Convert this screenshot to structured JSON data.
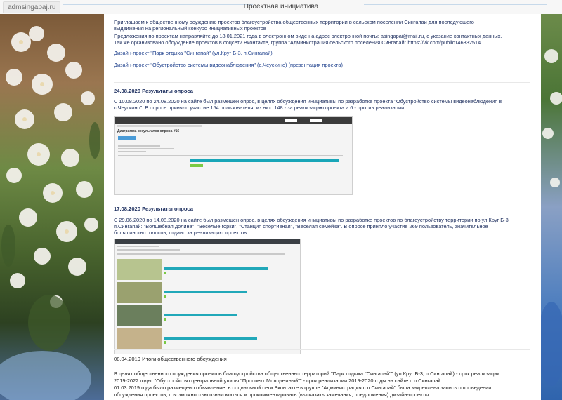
{
  "site_tab": "admsingapaj.ru",
  "page_caption": "Проектная инициатива",
  "intro": {
    "line1": "Приглашаем к общественному осуждению проектов благоустройства общественных территории в сельском поселении Сингапаи для последующего",
    "line2": "выдвижения на региональный конкурс инициативных проектов",
    "line3": "Предложения по проектам направляйте до 18.01.2021 года в электронном виде на адрес электронной почты: asingapai@mail.ru, с указание контактных данных.",
    "line4": "Так же организовано обсуждение проектов в соцсети Вконтакте, группа \"Администрация сельского поселения Сингапай\" https://vk.com/public146332514",
    "link1": "Дизайн-проект \"Парк отдыха \"Сингапай\" (ул.Круг Б-3, п.Сингапай)",
    "link2": "Дизайн-проект \"Обустройство системы видеонаблюдения\" (с.Чеускино) (презентация проекта)"
  },
  "section1": {
    "date": "24.08.2020 Результаты опроса",
    "line1": "С 10.08.2020 по 24.08.2020 на сайте был размещен опрос, в целях обсуждения инициативы по разработке проекта \"Обустройство системы видеонаблюдения в",
    "line2": "с.Чеускино\". В опросе приняло участие 154 пользователя, из них: 148 - за реализацию проекта и 6 - против реализации.",
    "shot_title": "Диаграмма результатов опроса #16"
  },
  "section2": {
    "date": "17.08.2020 Результаты опроса",
    "line1": "С 29.06.2020 по 14.08.2020 на сайте был размещен опрос, в целях обсуждения инициативы по разработке проектов по благоустройству территории по ул.Круг Б-3",
    "line2": "п.Сингапай: \"Волшебная долина\", \"Веселые горки\", \"Станция спортивная\", \"Веселая семейка\". В опросе приняло участие 269 пользователь, значительное",
    "line3": "большинство голосов, отдано за реализацию проектов."
  },
  "section3": {
    "date": "08.04.2019 Итоги общественного обсуждения",
    "line1": "В целях общественного осуждения проектов благоустройства общественных территорий \"Парк отдыха \"Сингапай\"\" (ул.Круг Б-3, п.Сингапай) - срок реализации",
    "line2": "2019-2022 годы, \"Обустройство центральной улицы \"Проспект Молодежный\"\" - срок реализации 2019-2020 годы на сайте с.п.Сингапай",
    "line3": "01.03.2019 года было размещено объявление,  в социальной сети Вконтакте в группе \"Администрация с.п.Сингапай\" была закреплена запись о проведении",
    "line4": "обсуждения проектов, с возможностью ознакомиться и прокомментировать (высказать замечания, предложения) дизайн-проекты."
  },
  "poll1": {
    "yes_share": 0.96,
    "no_share": 0.04
  },
  "poll2": {
    "bars": [
      0.78,
      0.62,
      0.55,
      0.7
    ]
  },
  "colors": {
    "text": "#1b2c5c",
    "link": "#1d3f8c",
    "bar_blue": "#19a6b8",
    "bar_green": "#7ac943"
  }
}
